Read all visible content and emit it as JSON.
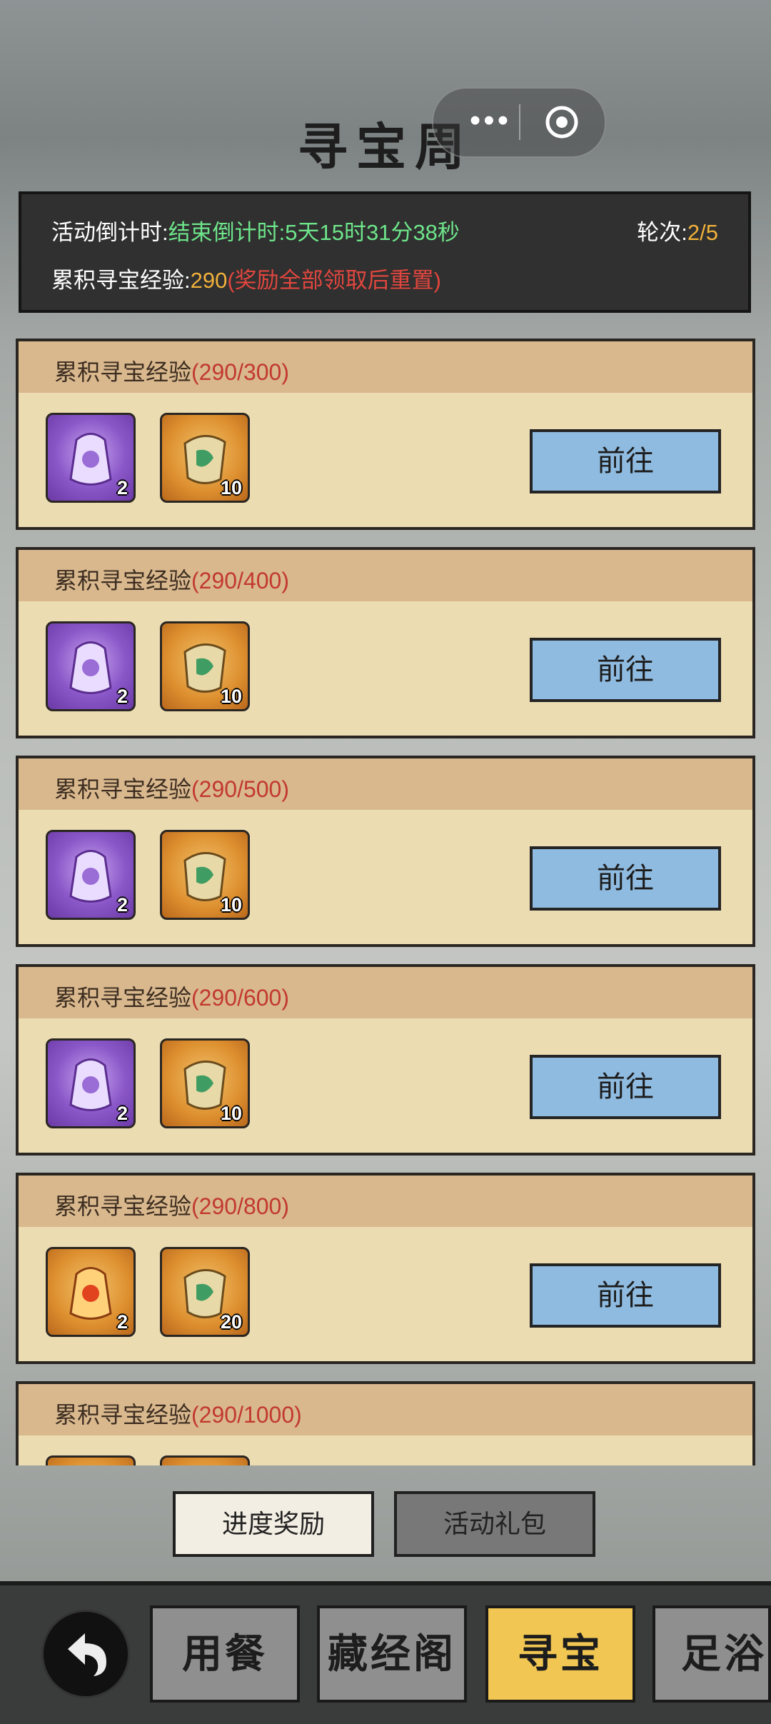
{
  "header": {
    "title": "寻宝周"
  },
  "info": {
    "countdown_label": "活动倒计时:",
    "countdown_value": "结束倒计时:5天15时31分38秒",
    "round_label": "轮次:",
    "round_value": "2/5",
    "exp_label": "累积寻宝经验:",
    "exp_value": "290",
    "exp_note": "(奖励全部领取后重置)"
  },
  "cards": [
    {
      "label": "累积寻宝经验",
      "progress": "(290/300)",
      "items": [
        {
          "type": "purple-pouch",
          "qty": "2"
        },
        {
          "type": "jade-scroll",
          "qty": "10"
        }
      ],
      "button": "前往"
    },
    {
      "label": "累积寻宝经验",
      "progress": "(290/400)",
      "items": [
        {
          "type": "purple-pouch",
          "qty": "2"
        },
        {
          "type": "jade-scroll",
          "qty": "10"
        }
      ],
      "button": "前往"
    },
    {
      "label": "累积寻宝经验",
      "progress": "(290/500)",
      "items": [
        {
          "type": "purple-pouch",
          "qty": "2"
        },
        {
          "type": "jade-scroll",
          "qty": "10"
        }
      ],
      "button": "前往"
    },
    {
      "label": "累积寻宝经验",
      "progress": "(290/600)",
      "items": [
        {
          "type": "purple-pouch",
          "qty": "2"
        },
        {
          "type": "jade-scroll",
          "qty": "10"
        }
      ],
      "button": "前往"
    },
    {
      "label": "累积寻宝经验",
      "progress": "(290/800)",
      "items": [
        {
          "type": "orange-pouch",
          "qty": "2"
        },
        {
          "type": "jade-scroll",
          "qty": "20"
        }
      ],
      "button": "前往"
    },
    {
      "label": "累积寻宝经验",
      "progress": "(290/1000)",
      "items": [],
      "button": ""
    }
  ],
  "tabs": {
    "progress_reward": "进度奖励",
    "activity_gift": "活动礼包"
  },
  "nav": {
    "dining": "用餐",
    "library": "藏经阁",
    "treasure": "寻宝",
    "foot_bath": "足浴"
  },
  "colors": {
    "accent": "#f1c652",
    "button_blue": "#8fbbe0",
    "highlight_green": "#6ee58b",
    "highlight_orange": "#f2b13c",
    "alert_red": "#e0463f"
  }
}
